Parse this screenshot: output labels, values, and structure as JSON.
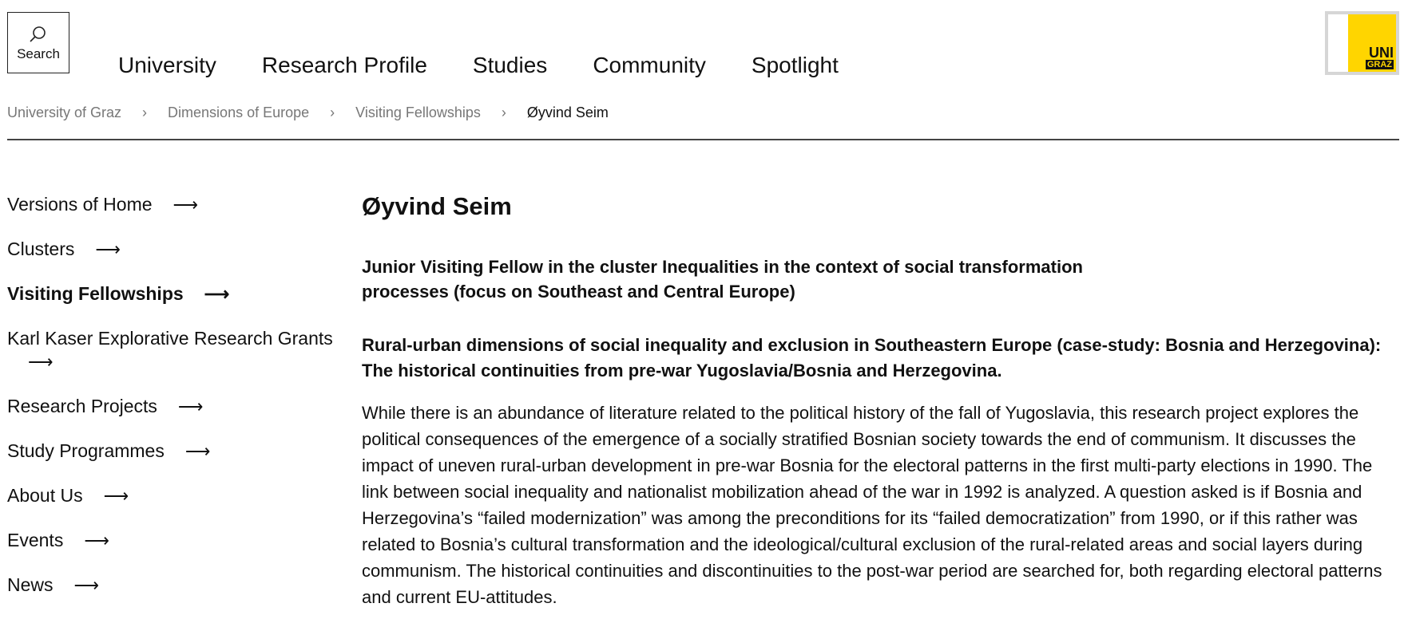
{
  "header": {
    "search_label": "Search",
    "nav": [
      "University",
      "Research Profile",
      "Studies",
      "Community",
      "Spotlight"
    ],
    "logo": {
      "line1": "UNI",
      "line2": "GRAZ",
      "accent_color": "#ffd500"
    }
  },
  "breadcrumb": {
    "items": [
      "University of Graz",
      "Dimensions of Europe",
      "Visiting Fellowships",
      "Øyvind Seim"
    ],
    "separator": "›"
  },
  "sidebar": {
    "arrow": "⟶",
    "items": [
      {
        "label": "Versions of Home"
      },
      {
        "label": "Clusters"
      },
      {
        "label": "Visiting Fellowships",
        "active": true
      },
      {
        "label": "Karl Kaser Explorative Research Grants"
      },
      {
        "label": "Research Projects"
      },
      {
        "label": "Study Programmes"
      },
      {
        "label": "About Us"
      },
      {
        "label": "Events"
      },
      {
        "label": "News"
      }
    ]
  },
  "main": {
    "title": "Øyvind Seim",
    "subtitle": "Junior Visiting Fellow in the cluster Inequalities in the context of social transformation processes (focus on Southeast and Central Europe)",
    "project_title": "Rural-urban dimensions of social inequality and exclusion in Southeastern Europe (case-study: Bosnia and Herzegovina): The historical continuities from pre-war Yugoslavia/Bosnia and Herzegovina.",
    "body": "While there is an abundance of literature related to the political history of the fall of Yugoslavia, this research project explores the political consequences of the emergence of a socially stratified Bosnian society towards the end of communism. It discusses the impact of uneven rural-urban development in pre-war Bosnia for the electoral patterns in the first multi-party elections in 1990. The link between social inequality and nationalist mobilization ahead of the war in 1992 is analyzed. A question asked is if Bosnia and Herzegovina’s “failed modernization” was among the preconditions for its “failed democratization” from 1990, or if this rather was related to Bosnia’s cultural transformation and the ideological/cultural exclusion of the rural-related areas and social layers during communism. The historical continuities and discontinuities to the post-war period are searched for, both regarding electoral patterns and current EU-attitudes."
  }
}
